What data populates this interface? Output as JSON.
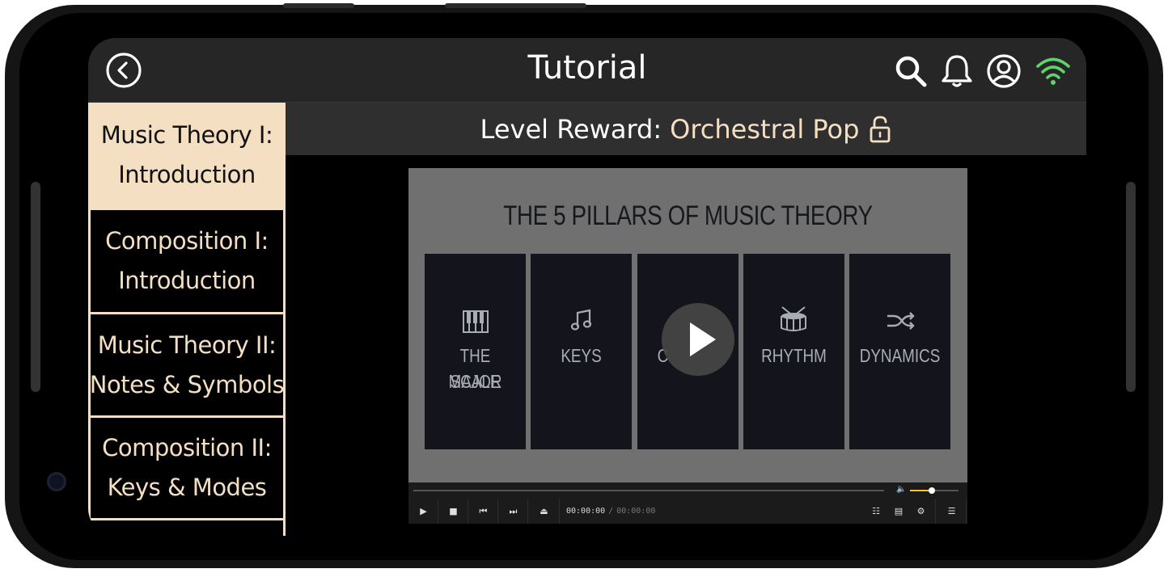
{
  "header": {
    "title": "Tutorial",
    "icons": [
      "back-icon",
      "search-icon",
      "bell-icon",
      "account-icon",
      "wifi-icon"
    ],
    "wifi_color": "#5fd36a"
  },
  "sidebar": {
    "items": [
      {
        "line1": "Music Theory I:",
        "line2": "Introduction",
        "active": true
      },
      {
        "line1": "Composition I:",
        "line2": "Introduction",
        "active": false
      },
      {
        "line1": "Music Theory II:",
        "line2": "Notes & Symbols",
        "active": false
      },
      {
        "line1": "Composition II:",
        "line2": "Keys & Modes",
        "active": false
      }
    ]
  },
  "reward": {
    "label": "Level Reward:",
    "value": "Orchestral Pop",
    "icon": "unlock-icon"
  },
  "video": {
    "title": "THE 5 PILLARS OF MUSIC THEORY",
    "pillars": [
      {
        "icon": "piano-icon",
        "line1": "THE MAJOR",
        "line2": "SCALE"
      },
      {
        "icon": "music-note-icon",
        "line1": "KEYS",
        "line2": ""
      },
      {
        "icon": "chords-icon",
        "line1": "C",
        "line2": ""
      },
      {
        "icon": "drum-icon",
        "line1": "RHYTHM",
        "line2": ""
      },
      {
        "icon": "shuffle-icon",
        "line1": "DYNAMICS",
        "line2": ""
      }
    ],
    "controls": {
      "current_time": "00:00:00",
      "separator": "/",
      "duration": "00:00:00",
      "volume_level": 0.45,
      "progress": 0
    }
  },
  "colors": {
    "accent": "#f4dfc2",
    "topbar": "#262626",
    "reward_bar": "#2f2f2f"
  }
}
